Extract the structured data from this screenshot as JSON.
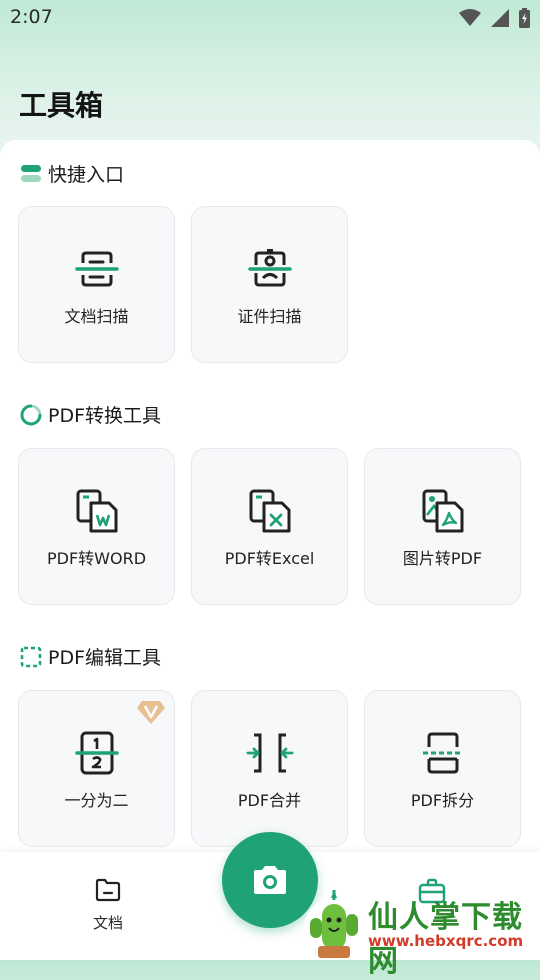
{
  "status": {
    "time": "2:07"
  },
  "page": {
    "title": "工具箱"
  },
  "sections": [
    {
      "title": "快捷入口",
      "items": [
        {
          "label": "文档扫描"
        },
        {
          "label": "证件扫描"
        }
      ]
    },
    {
      "title": "PDF转换工具",
      "items": [
        {
          "label": "PDF转WORD"
        },
        {
          "label": "PDF转Excel"
        },
        {
          "label": "图片转PDF"
        }
      ]
    },
    {
      "title": "PDF编辑工具",
      "items": [
        {
          "label": "一分为二",
          "vip": true
        },
        {
          "label": "PDF合并"
        },
        {
          "label": "PDF拆分"
        }
      ]
    }
  ],
  "bottom_nav": {
    "items": [
      {
        "label": "文档"
      }
    ]
  },
  "watermark": {
    "title": "仙人掌下载网",
    "url": "www.hebxqrc.com"
  },
  "colors": {
    "accent": "#1fa374",
    "vip": "#d9a46a"
  }
}
